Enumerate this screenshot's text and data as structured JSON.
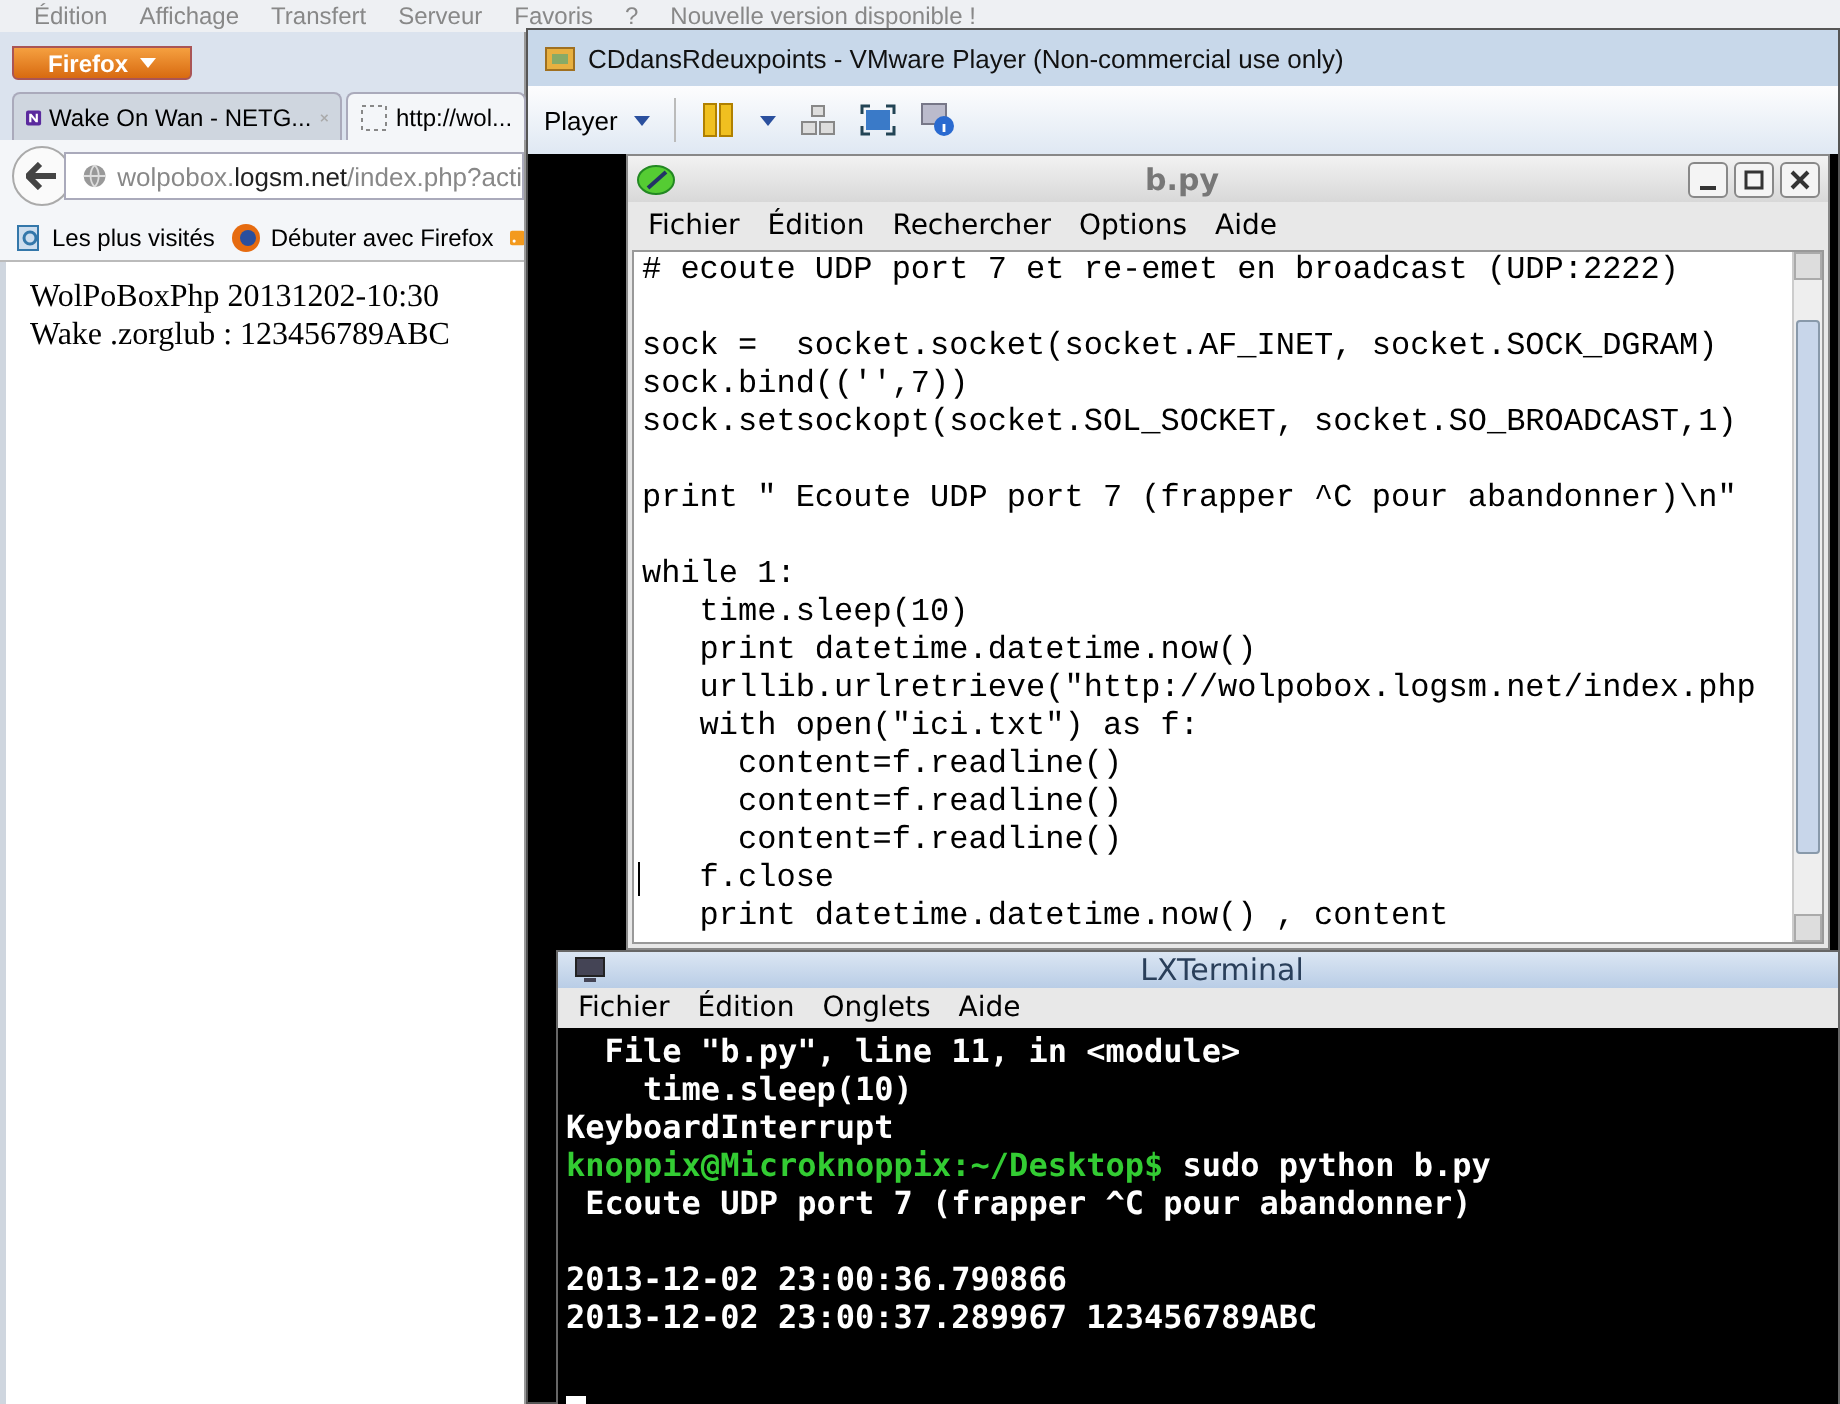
{
  "background_menu": [
    "Édition",
    "Affichage",
    "Transfert",
    "Serveur",
    "Favoris",
    "?",
    "Nouvelle version disponible !"
  ],
  "firefox": {
    "menu_button": "Firefox",
    "tabs": [
      {
        "label": "Wake On Wan - NETG...",
        "selected": false
      },
      {
        "label": "http://wol...",
        "selected": true
      }
    ],
    "url": {
      "host_pre": "wolpobox.",
      "host": "logsm.net",
      "path": "/index.php?acti"
    },
    "bookmarks": [
      "Les plus visités",
      "Débuter avec Firefox"
    ],
    "content": [
      "WolPoBoxPhp 20131202-10:30",
      "Wake .zorglub : 123456789ABC"
    ]
  },
  "vmware": {
    "title": "CDdansRdeuxpoints - VMware Player (Non-commercial use only)",
    "menu": "Player"
  },
  "editor": {
    "title": "b.py",
    "menu": [
      "Fichier",
      "Édition",
      "Rechercher",
      "Options",
      "Aide"
    ],
    "lines": [
      {
        "kind": "code",
        "text": "# ecoute UDP port 7 et re-emet en broadcast (UDP:2222)"
      },
      {
        "kind": "blank"
      },
      {
        "kind": "code",
        "text": "sock =  socket.socket(socket.AF_INET, socket.SOCK_DGRAM)"
      },
      {
        "kind": "code",
        "text": "sock.bind(('',7))"
      },
      {
        "kind": "code",
        "text": "sock.setsockopt(socket.SOL_SOCKET, socket.SO_BROADCAST,1)"
      },
      {
        "kind": "blank"
      },
      {
        "kind": "code",
        "text": "print \" Ecoute UDP port 7 (frapper ^C pour abandonner)\\n\""
      },
      {
        "kind": "blank"
      },
      {
        "kind": "code",
        "text": "while 1:"
      },
      {
        "kind": "code",
        "text": "   time.sleep(10)"
      },
      {
        "kind": "code",
        "text": "   print datetime.datetime.now()"
      },
      {
        "kind": "code",
        "text": "   urllib.urlretrieve(\"http://wolpobox.logsm.net/index.php"
      },
      {
        "kind": "code",
        "text": "   with open(\"ici.txt\") as f:"
      },
      {
        "kind": "code",
        "text": "     content=f.readline()"
      },
      {
        "kind": "code",
        "text": "     content=f.readline()"
      },
      {
        "kind": "code",
        "text": "     content=f.readline()"
      },
      {
        "kind": "code",
        "text": "   f.close",
        "cursor": true
      },
      {
        "kind": "code",
        "text": "   print datetime.datetime.now() , content"
      }
    ]
  },
  "terminal": {
    "title": "LXTerminal",
    "menu": [
      "Fichier",
      "Édition",
      "Onglets",
      "Aide"
    ],
    "lines": [
      {
        "kind": "output",
        "text": "  File \"b.py\", line 11, in <module>"
      },
      {
        "kind": "output",
        "text": "    time.sleep(10)"
      },
      {
        "kind": "output",
        "text": "KeyboardInterrupt"
      },
      {
        "kind": "prompt",
        "prompt": "knoppix@Microknoppix:~/Desktop$",
        "text": " sudo python b.py"
      },
      {
        "kind": "output",
        "text": " Ecoute UDP port 7 (frapper ^C pour abandonner)"
      },
      {
        "kind": "blank"
      },
      {
        "kind": "output",
        "text": "2013-12-02 23:00:36.790866"
      },
      {
        "kind": "output",
        "text": "2013-12-02 23:00:37.289967 123456789ABC"
      },
      {
        "kind": "blank"
      },
      {
        "kind": "cursor"
      }
    ]
  }
}
